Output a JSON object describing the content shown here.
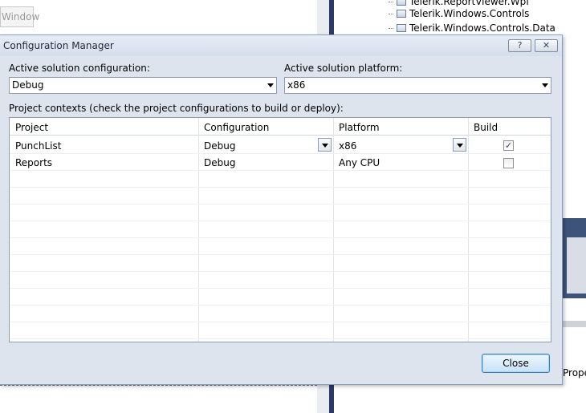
{
  "background": {
    "window_tab_label": "Window",
    "tree_items": [
      "Telerik.ReportViewer.Wpf",
      "Telerik.Windows.Controls",
      "Telerik.Windows.Controls.Data"
    ],
    "properties_label": "Prope"
  },
  "dialog": {
    "title": "Configuration Manager",
    "help_glyph": "?",
    "close_glyph": "✕",
    "active_config_label": "Active solution configuration:",
    "active_config_value": "Debug",
    "active_platform_label": "Active solution platform:",
    "active_platform_value": "x86",
    "project_contexts_label": "Project contexts (check the project configurations to build or deploy):",
    "close_button_label": "Close"
  },
  "grid": {
    "columns": [
      "Project",
      "Configuration",
      "Platform",
      "Build"
    ],
    "rows": [
      {
        "project": "PunchList",
        "configuration": "Debug",
        "platform": "x86",
        "build": true
      },
      {
        "project": "Reports",
        "configuration": "Debug",
        "platform": "Any CPU",
        "build": false
      }
    ]
  },
  "colors": {
    "dialog_bg": "#dde4ee",
    "accent_navy": "#2b3a67",
    "button_border": "#3c7fb1"
  }
}
